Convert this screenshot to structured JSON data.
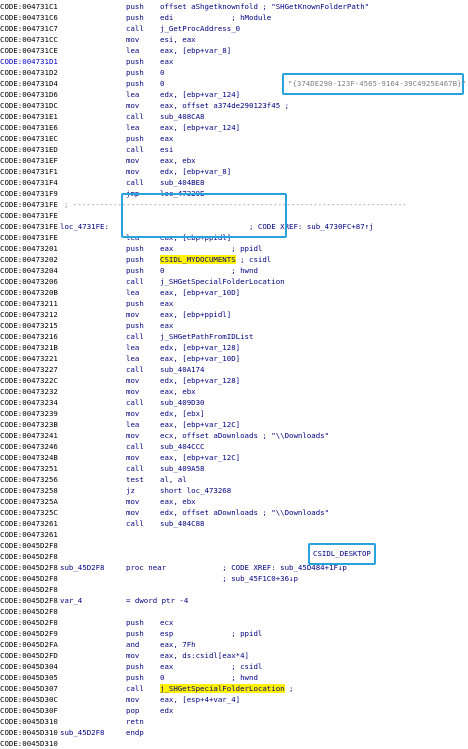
{
  "rows": [
    {
      "a": "CODE:004731C1",
      "m": "push",
      "o": "offset aShgetknownfold ; \"SHGetKnownFolderPath\""
    },
    {
      "a": "CODE:004731C6",
      "m": "push",
      "o": "edi             ; hModule"
    },
    {
      "a": "CODE:004731C7",
      "m": "call",
      "o": "j_GetProcAddress_0"
    },
    {
      "a": "CODE:004731CC",
      "m": "mov",
      "o": "esi, eax"
    },
    {
      "a": "CODE:004731CE",
      "m": "lea",
      "o": "eax, [ebp+var_8]"
    },
    {
      "a": "CODE:004731D1",
      "m": "push",
      "o": "eax",
      "blue": true
    },
    {
      "a": "CODE:004731D2",
      "m": "push",
      "o": "0"
    },
    {
      "a": "CODE:004731D4",
      "m": "push",
      "o": "0"
    },
    {
      "a": "CODE:004731D6",
      "m": "lea",
      "o": "edx, [ebp+var_124]"
    },
    {
      "a": "CODE:004731DC",
      "m": "mov",
      "o": "eax, offset a374de290123f45 ;"
    },
    {
      "a": "CODE:004731E1",
      "m": "call",
      "o": "sub_408CA8"
    },
    {
      "a": "CODE:004731E6",
      "m": "lea",
      "o": "eax, [ebp+var_124]"
    },
    {
      "a": "CODE:004731EC",
      "m": "push",
      "o": "eax"
    },
    {
      "a": "CODE:004731ED",
      "m": "call",
      "o": "esi"
    },
    {
      "a": "CODE:004731EF",
      "m": "mov",
      "o": "eax, ebx"
    },
    {
      "a": "CODE:004731F1",
      "m": "mov",
      "o": "edx, [ebp+var_8]"
    },
    {
      "a": "CODE:004731F4",
      "m": "call",
      "o": "sub_404BE8"
    },
    {
      "a": "CODE:004731F9",
      "m": "jmp",
      "o": "loc_47329E"
    },
    {
      "a": "CODE:004731FE",
      "c": "; ---------------------------------------------------------------------------"
    },
    {
      "a": "CODE:004731FE",
      "m": "",
      "o": ""
    },
    {
      "a": "CODE:004731FE",
      "l": "loc_4731FE:",
      "m": "",
      "o": "                    ; CODE XREF: sub_4730FC+87↑j"
    },
    {
      "a": "CODE:004731FE",
      "m": "lea",
      "o": "eax, [ebp+ppidl]"
    },
    {
      "a": "CODE:00473201",
      "m": "push",
      "o": "eax             ; ppidl"
    },
    {
      "a": "CODE:00473202",
      "m": "push",
      "o": "CSIDL_MYDOCUMENTS ; csidl",
      "hl": "CSIDL_MYDOCUMENTS"
    },
    {
      "a": "CODE:00473204",
      "m": "push",
      "o": "0               ; hwnd"
    },
    {
      "a": "CODE:00473206",
      "m": "call",
      "o": "j_SHGetSpecialFolderLocation"
    },
    {
      "a": "CODE:0047320B",
      "m": "lea",
      "o": "eax, [ebp+var_10D]"
    },
    {
      "a": "CODE:00473211",
      "m": "push",
      "o": "eax"
    },
    {
      "a": "CODE:00473212",
      "m": "mov",
      "o": "eax, [ebp+ppidl]"
    },
    {
      "a": "CODE:00473215",
      "m": "push",
      "o": "eax"
    },
    {
      "a": "CODE:00473216",
      "m": "call",
      "o": "j_SHGetPathFromIDList"
    },
    {
      "a": "CODE:0047321B",
      "m": "lea",
      "o": "edx, [ebp+var_128]"
    },
    {
      "a": "CODE:00473221",
      "m": "lea",
      "o": "eax, [ebp+var_10D]"
    },
    {
      "a": "CODE:00473227",
      "m": "call",
      "o": "sub_40A174"
    },
    {
      "a": "CODE:0047322C",
      "m": "mov",
      "o": "edx, [ebp+var_128]"
    },
    {
      "a": "CODE:00473232",
      "m": "mov",
      "o": "eax, ebx"
    },
    {
      "a": "CODE:00473234",
      "m": "call",
      "o": "sub_409D30"
    },
    {
      "a": "CODE:00473239",
      "m": "mov",
      "o": "edx, [ebx]"
    },
    {
      "a": "CODE:0047323B",
      "m": "lea",
      "o": "eax, [ebp+var_12C]"
    },
    {
      "a": "CODE:00473241",
      "m": "mov",
      "o": "ecx, offset aDownloads ; \"\\\\Downloads\""
    },
    {
      "a": "CODE:00473246",
      "m": "call",
      "o": "sub_404CCC"
    },
    {
      "a": "CODE:0047324B",
      "m": "mov",
      "o": "eax, [ebp+var_12C]"
    },
    {
      "a": "CODE:00473251",
      "m": "call",
      "o": "sub_409A58"
    },
    {
      "a": "CODE:00473256",
      "m": "test",
      "o": "al, al"
    },
    {
      "a": "CODE:00473258",
      "m": "jz",
      "o": "short loc_473268"
    },
    {
      "a": "CODE:0047325A",
      "m": "mov",
      "o": "eax, ebx"
    },
    {
      "a": "CODE:0047325C",
      "m": "mov",
      "o": "edx, offset aDownloads ; \"\\\\Downloads\""
    },
    {
      "a": "CODE:00473261",
      "m": "call",
      "o": "sub_404C88"
    },
    {
      "a": "CODE:00473261",
      "m": "",
      "o": ""
    },
    {
      "a": "CODE:0045D2F8",
      "m": "",
      "o": ""
    },
    {
      "a": "CODE:0045D2F8",
      "m": "",
      "o": ""
    },
    {
      "a": "CODE:0045D2F8",
      "l": "sub_45D2F8",
      "m": "proc near",
      "o": "              ; CODE XREF: sub_45D484+1F↓p"
    },
    {
      "a": "CODE:0045D2F8",
      "m": "",
      "o": "              ; sub_45F1C0+36↓p"
    },
    {
      "a": "CODE:0045D2F8",
      "m": "",
      "o": ""
    },
    {
      "a": "CODE:0045D2F8",
      "l": "var_4",
      "m": "= dword ptr -4",
      "o": ""
    },
    {
      "a": "CODE:0045D2F8",
      "m": "",
      "o": ""
    },
    {
      "a": "CODE:0045D2F8",
      "m": "push",
      "o": "ecx"
    },
    {
      "a": "CODE:0045D2F9",
      "m": "push",
      "o": "esp             ; ppidl"
    },
    {
      "a": "CODE:0045D2FA",
      "m": "and",
      "o": "eax, 7Fh"
    },
    {
      "a": "CODE:0045D2FD",
      "m": "mov",
      "o": "eax, ds:csidl[eax*4]"
    },
    {
      "a": "CODE:0045D304",
      "m": "push",
      "o": "eax             ; csidl"
    },
    {
      "a": "CODE:0045D305",
      "m": "push",
      "o": "0               ; hwnd"
    },
    {
      "a": "CODE:0045D307",
      "m": "call",
      "o": "j_SHGetSpecialFolderLocation ;",
      "hl": "j_SHGetSpecialFolderLocation"
    },
    {
      "a": "CODE:0045D30C",
      "m": "mov",
      "o": "eax, [esp+4+var_4]"
    },
    {
      "a": "CODE:0045D30F",
      "m": "pop",
      "o": "edx"
    },
    {
      "a": "CODE:0045D310",
      "m": "retn",
      "o": ""
    },
    {
      "a": "CODE:0045D310",
      "l": "sub_45D2F8",
      "m": "endp",
      "o": ""
    },
    {
      "a": "CODE:0045D310",
      "m": "",
      "o": ""
    }
  ],
  "annotations": {
    "guid": "\"{374DE290-123F-4565-9164-39C4925E467B}\"",
    "csidl_desktop": "CSIDL_DESKTOP"
  },
  "colors": {
    "highlight": "#fff200",
    "box": "#29a3e0",
    "text": "#000080"
  }
}
